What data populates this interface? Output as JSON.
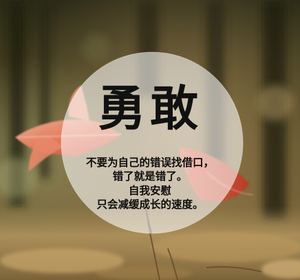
{
  "poster": {
    "title": "勇敢",
    "lines": [
      "不要为自己的错误找借口，",
      "错了就是错了。",
      "自我安慰",
      "只会减缓成长的速度。"
    ]
  },
  "colors": {
    "leaf": "#e0664a",
    "background_dark": "#2e2d1a",
    "background_warm": "#8a6d3a",
    "circle_overlay": "#ffffff"
  }
}
